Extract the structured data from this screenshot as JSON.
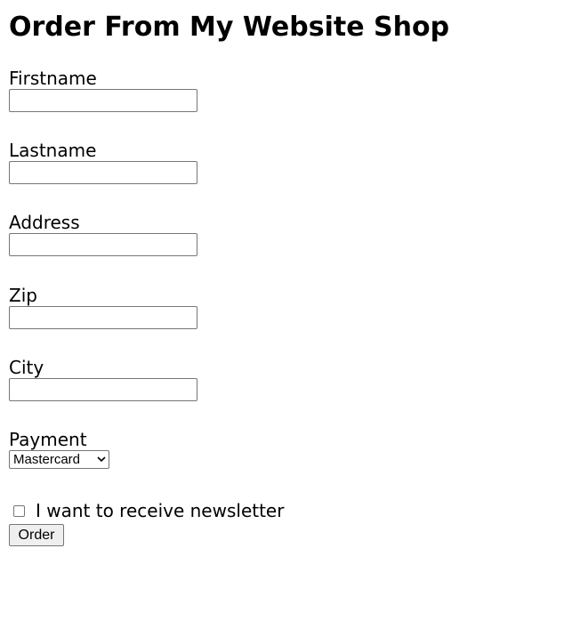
{
  "page": {
    "title": "Order From My Website Shop"
  },
  "form": {
    "firstname": {
      "label": "Firstname",
      "value": ""
    },
    "lastname": {
      "label": "Lastname",
      "value": ""
    },
    "address": {
      "label": "Address",
      "value": ""
    },
    "zip": {
      "label": "Zip",
      "value": ""
    },
    "city": {
      "label": "City",
      "value": ""
    },
    "payment": {
      "label": "Payment",
      "selected": "Mastercard"
    },
    "newsletter": {
      "label": "I want to receive newsletter",
      "checked": false
    },
    "order_label": "Order"
  },
  "icons": {
    "payment_dropdown": "chevron-down-icon"
  }
}
